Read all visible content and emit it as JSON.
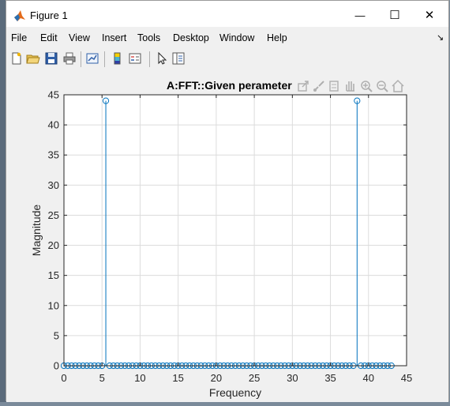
{
  "window": {
    "title": "Figure 1",
    "minimize_glyph": "—",
    "maximize_glyph": "☐",
    "close_glyph": "✕"
  },
  "menu": {
    "items": [
      "File",
      "Edit",
      "View",
      "Insert",
      "Tools",
      "Desktop",
      "Window",
      "Help"
    ],
    "dock_glyph": "↘"
  },
  "toolbar": {
    "icons": [
      "new-figure-icon",
      "open-file-icon",
      "save-icon",
      "print-icon",
      "link-plot-icon",
      "insert-colorbar-icon",
      "insert-legend-icon",
      "edit-plot-icon",
      "property-inspector-icon"
    ]
  },
  "axes_toolbar": {
    "icons": [
      "export-icon",
      "brush-icon",
      "datatip-icon",
      "pan-icon",
      "zoom-in-icon",
      "zoom-out-icon",
      "home-icon"
    ]
  },
  "colors": {
    "stem": "#0072bd",
    "grid": "#dcdcdc",
    "axes_bg": "#ffffff",
    "figure_bg": "#f0f0f0"
  },
  "chart_data": {
    "type": "stem",
    "title": "A:FFT::Given perameter",
    "xlabel": "Frequency",
    "ylabel": "Magnitude",
    "xlim": [
      0,
      45
    ],
    "ylim": [
      0,
      45
    ],
    "xticks": [
      0,
      5,
      10,
      15,
      20,
      25,
      30,
      35,
      40,
      45
    ],
    "yticks": [
      0,
      5,
      10,
      15,
      20,
      25,
      30,
      35,
      40,
      45
    ],
    "grid": true,
    "series": [
      {
        "x": [
          0,
          0.5,
          1,
          1.5,
          2,
          2.5,
          3,
          3.5,
          4,
          4.5,
          5,
          5.5,
          6,
          6.5,
          7,
          7.5,
          8,
          8.5,
          9,
          9.5,
          10,
          10.5,
          11,
          11.5,
          12,
          12.5,
          13,
          13.5,
          14,
          14.5,
          15,
          15.5,
          16,
          16.5,
          17,
          17.5,
          18,
          18.5,
          19,
          19.5,
          20,
          20.5,
          21,
          21.5,
          22,
          22.5,
          23,
          23.5,
          24,
          24.5,
          25,
          25.5,
          26,
          26.5,
          27,
          27.5,
          28,
          28.5,
          29,
          29.5,
          30,
          30.5,
          31,
          31.5,
          32,
          32.5,
          33,
          33.5,
          34,
          34.5,
          35,
          35.5,
          36,
          36.5,
          37,
          37.5,
          38,
          38.5,
          39,
          39.5,
          40,
          40.5,
          41,
          41.5,
          42,
          42.5,
          43
        ],
        "y": [
          0,
          0,
          0,
          0,
          0,
          0,
          0,
          0,
          0,
          0,
          0,
          44,
          0,
          0,
          0,
          0,
          0,
          0,
          0,
          0,
          0,
          0,
          0,
          0,
          0,
          0,
          0,
          0,
          0,
          0,
          0,
          0,
          0,
          0,
          0,
          0,
          0,
          0,
          0,
          0,
          0,
          0,
          0,
          0,
          0,
          0,
          0,
          0,
          0,
          0,
          0,
          0,
          0,
          0,
          0,
          0,
          0,
          0,
          0,
          0,
          0,
          0,
          0,
          0,
          0,
          0,
          0,
          0,
          0,
          0,
          0,
          0,
          0,
          0,
          0,
          0,
          0,
          44,
          0,
          0,
          0,
          0,
          0,
          0,
          0,
          0,
          0
        ]
      }
    ]
  }
}
